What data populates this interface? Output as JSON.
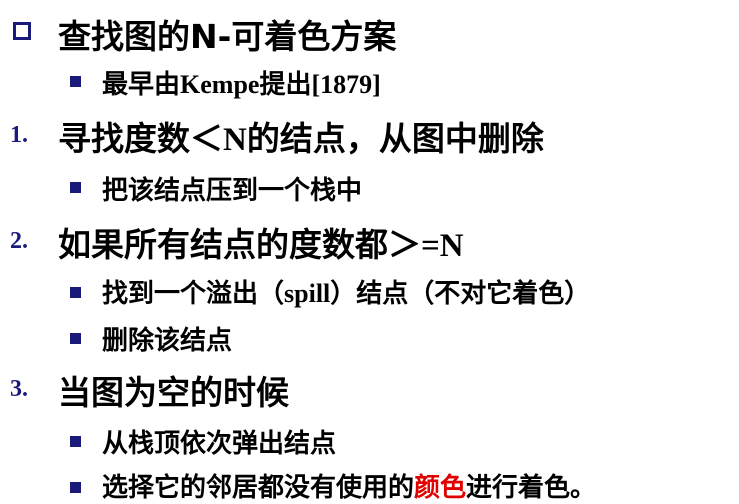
{
  "lines": {
    "title": {
      "text": "查找图的N-可着色方案"
    },
    "sub_kempe": {
      "text_a": "最早由",
      "text_b": "Kempe",
      "text_c": "提出",
      "text_d": "[1879]"
    },
    "step1": {
      "num": "1.",
      "text_a": "寻找度数＜",
      "text_b": "N",
      "text_c": "的结点，从图中删除"
    },
    "sub_push": {
      "text": "把该结点压到一个栈中"
    },
    "step2": {
      "num": "2.",
      "text_a": "如果所有结点的度数都＞",
      "text_b": "=N"
    },
    "sub_spill": {
      "text_a": "找到一个溢出（",
      "text_b": "spill",
      "text_c": "）结点（不对它着色）"
    },
    "sub_delete": {
      "text": "删除该结点"
    },
    "step3": {
      "num": "3.",
      "text": "当图为空的时候"
    },
    "sub_pop": {
      "text": "从栈顶依次弹出结点"
    },
    "sub_color": {
      "text_a": "选择它的邻居都没有使用的",
      "text_red": "颜色",
      "text_b": "进行着色。"
    }
  },
  "colors": {
    "bullet": "#1a1a7a",
    "text": "#000000",
    "highlight": "#e00000"
  }
}
